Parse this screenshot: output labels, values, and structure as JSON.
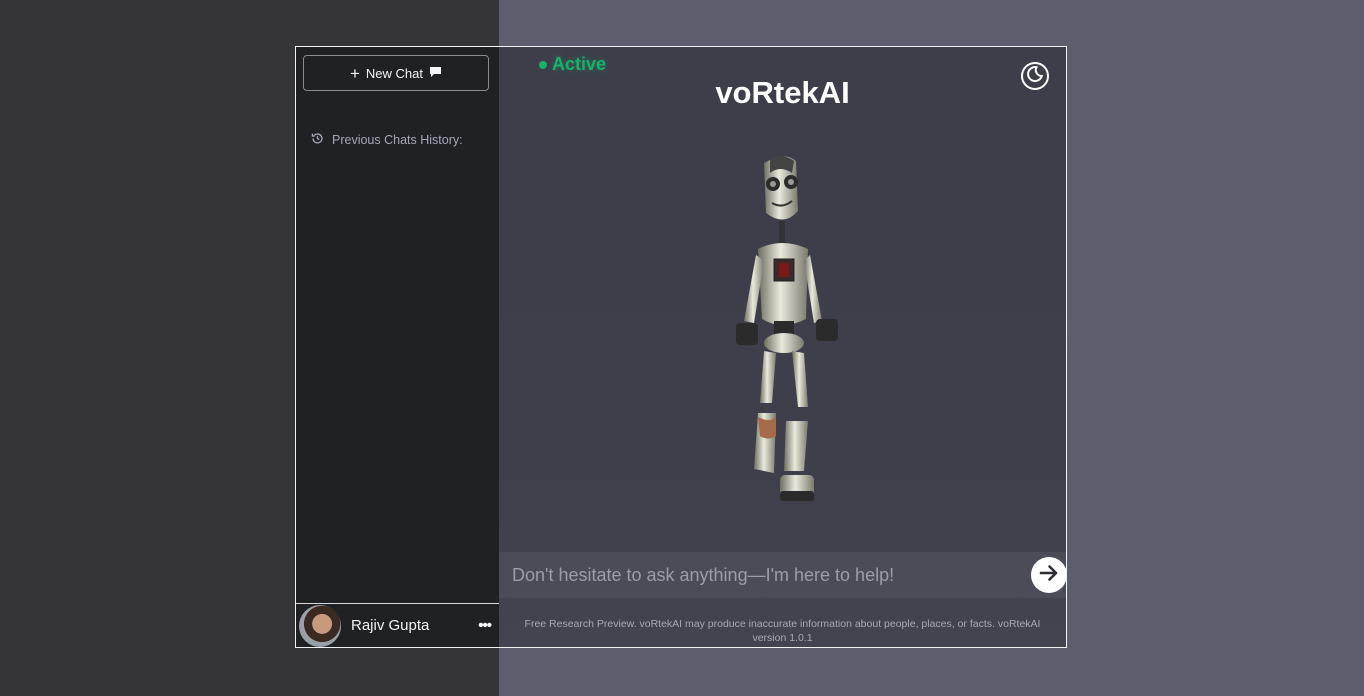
{
  "sidebar": {
    "new_chat_label": "New Chat",
    "history_label": "Previous Chats History:",
    "user": {
      "name": "Rajiv Gupta",
      "menu_label": "•••"
    }
  },
  "main": {
    "status_label": "Active",
    "title": "voRtekAI",
    "input_placeholder": "Don't hesitate to ask anything—I'm here to help!",
    "disclaimer": "Free Research Preview. voRtekAI may produce inaccurate information about people, places, or facts. voRtekAI version 1.0.1"
  },
  "colors": {
    "accent_active": "#17b26a",
    "sidebar_bg": "#202124",
    "main_bg": "#3e3e4a"
  },
  "icons": [
    "plus-icon",
    "chat-bubble-icon",
    "history-icon",
    "moon-icon",
    "arrow-right-icon",
    "ellipsis-icon"
  ]
}
